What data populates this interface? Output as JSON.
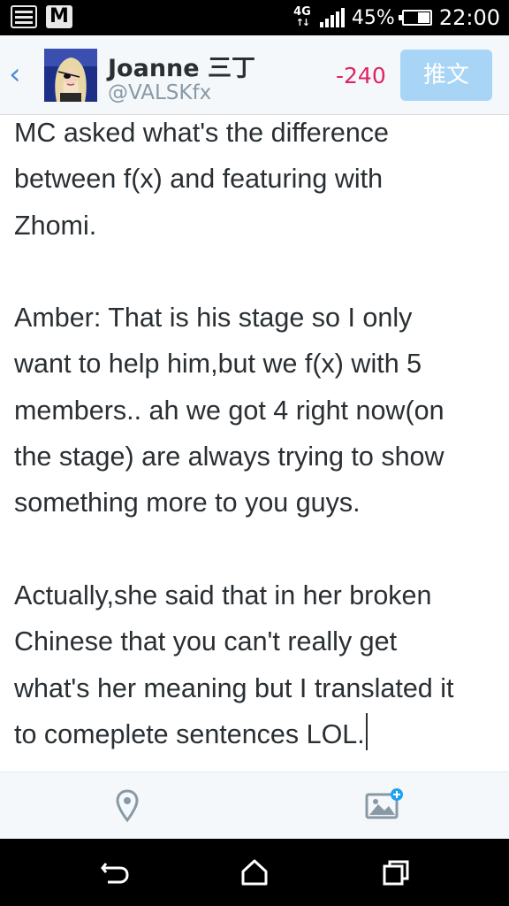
{
  "status_bar": {
    "network": "4G",
    "battery_percent": "45%",
    "battery_level": 0.45,
    "time": "22:00",
    "left_icons": [
      "gallery-icon",
      "gmail-icon"
    ]
  },
  "header": {
    "display_name": "Joanne 三丁",
    "handle": "@VALSKfx",
    "char_count": "-240",
    "tweet_button_label": "推文"
  },
  "compose": {
    "text": "MC asked what's the difference\nbetween f(x) and featuring with\nZhomi.\n\nAmber: That is his stage so I only\nwant to help him,but we f(x) with 5\nmembers.. ah we got 4 right now(on\nthe stage) are always trying to show\nsomething more to you guys.\n\nActually,she said that in her broken\nChinese that you can't really get\nwhat's her meaning but I translated it\nto comeplete sentences LOL."
  },
  "toolbar": {
    "icons": [
      "location-pin-icon",
      "add-photo-icon"
    ]
  },
  "navbar": {
    "icons": [
      "back-icon",
      "home-icon",
      "recent-apps-icon"
    ]
  },
  "colors": {
    "accent": "#4d8fd4",
    "tweet_button": "#a8d5f5",
    "count_negative": "#e0245e",
    "text": "#292f33",
    "handle": "#8899a6"
  }
}
